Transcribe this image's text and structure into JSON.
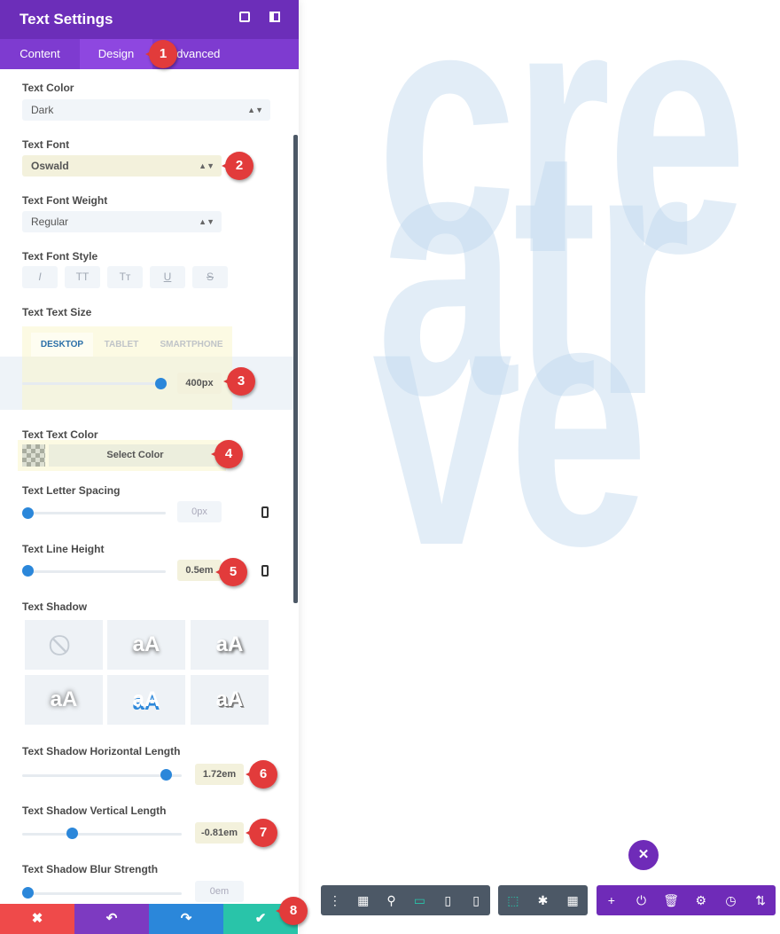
{
  "canvas": {
    "lines": [
      "cre",
      "atr",
      "ve"
    ]
  },
  "header": {
    "title": "Text Settings",
    "icons": [
      "expand-icon",
      "split-view-icon"
    ]
  },
  "tabs": [
    {
      "label": "Content"
    },
    {
      "label": "Design",
      "active": true
    },
    {
      "label": "Advanced"
    }
  ],
  "fields": {
    "text_color": {
      "label": "Text Color",
      "value": "Dark"
    },
    "text_font": {
      "label": "Text Font",
      "value": "Oswald"
    },
    "font_weight": {
      "label": "Text Font Weight",
      "value": "Regular"
    },
    "font_style": {
      "label": "Text Font Style",
      "buttons": [
        "I",
        "TT",
        "Tт",
        "U",
        "S"
      ]
    },
    "text_size": {
      "label": "Text Text Size",
      "devices": [
        "DESKTOP",
        "TABLET",
        "SMARTPHONE"
      ],
      "value": "400px"
    },
    "text_text_color": {
      "label": "Text Text Color",
      "button": "Select Color"
    },
    "letter_spacing": {
      "label": "Text Letter Spacing",
      "value": "0px"
    },
    "line_height": {
      "label": "Text Line Height",
      "value": "0.5em"
    },
    "text_shadow": {
      "label": "Text Shadow",
      "presets": [
        "none",
        "aA",
        "aA",
        "aA",
        "aA",
        "aA"
      ]
    },
    "shadow_h": {
      "label": "Text Shadow Horizontal Length",
      "value": "1.72em"
    },
    "shadow_v": {
      "label": "Text Shadow Vertical Length",
      "value": "-0.81em"
    },
    "shadow_blur": {
      "label": "Text Shadow Blur Strength",
      "value": "0em"
    }
  },
  "callouts": [
    "1",
    "2",
    "3",
    "4",
    "5",
    "6",
    "7",
    "8"
  ],
  "bottom_bar": {
    "cancel": "✖",
    "undo": "↶",
    "redo": "↷",
    "save": "✔"
  },
  "colors": {
    "header": "#6c2eb9",
    "tabs": "#7e3bd0",
    "cancel": "#ef4a4a",
    "undo": "#7d3ac1",
    "redo": "#2b87da",
    "save": "#29c4a9",
    "accent": "#2b87da"
  }
}
